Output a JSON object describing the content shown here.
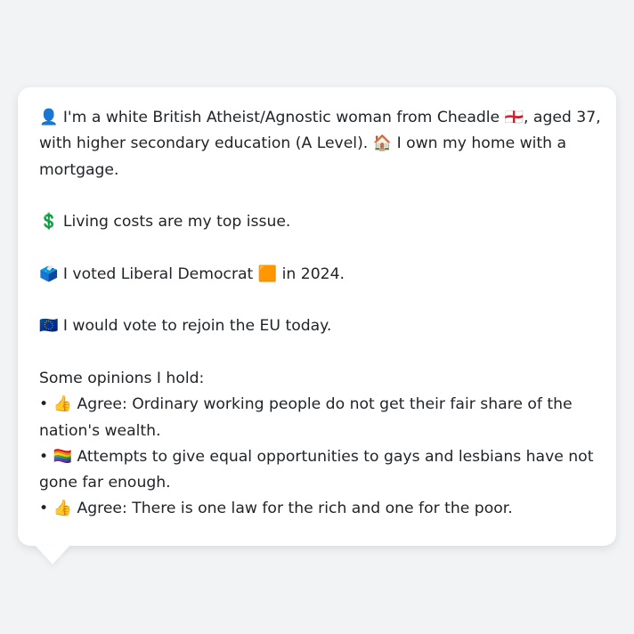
{
  "card": {
    "intro_line1": "👤 I'm a white British Atheist/Agnostic woman from Cheadle 🏴󠁧󠁢󠁥󠁮󠁧󠁿, aged 37,",
    "intro_line2": "with higher secondary education (A Level). 🏠 I own my home with a",
    "intro_line3": "mortgage.",
    "issue": "💲 Living costs are my top issue.",
    "vote": "🗳️ I voted Liberal Democrat 🟧 in 2024.",
    "eu": "🇪🇺 I would vote to rejoin the EU today.",
    "opinions_heading": "Some opinions I hold:",
    "opinion1_line1": "• 👍 Agree: Ordinary working people do not get their fair share of the",
    "opinion1_line2": "nation's wealth.",
    "opinion2_line1": "• 🏳️‍🌈 Attempts to give equal opportunities to gays and lesbians have not",
    "opinion2_line2": "gone far enough.",
    "opinion3_line1": "• 👍 Agree: There is one law for the rich and one for the poor."
  }
}
